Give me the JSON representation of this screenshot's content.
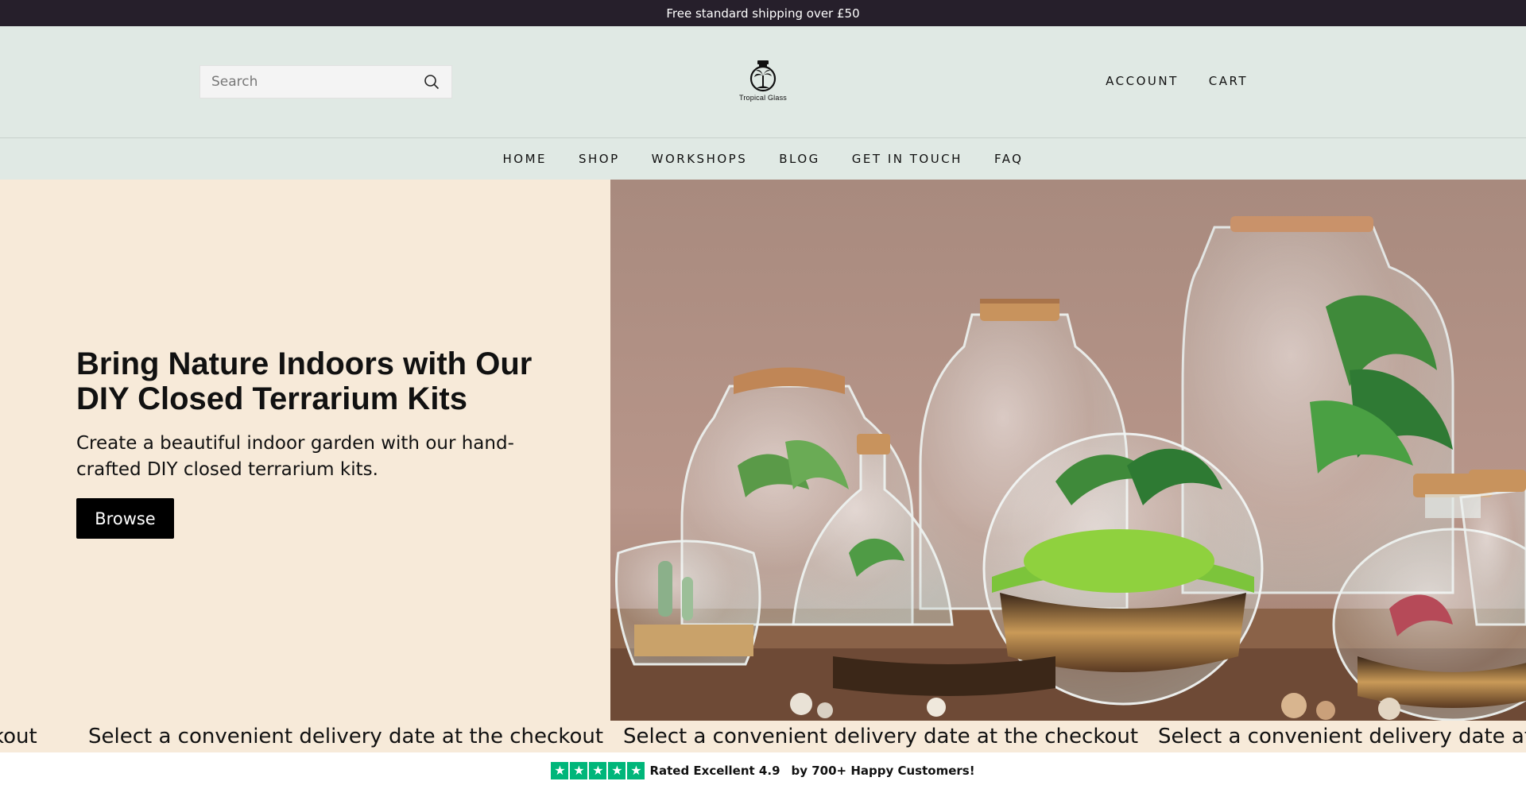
{
  "announcement": "Free standard shipping over £50",
  "header": {
    "search_placeholder": "Search",
    "search_icon": "search-icon",
    "logo_caption": "Tropical Glass",
    "account_label": "ACCOUNT",
    "cart_label": "CART"
  },
  "nav": {
    "items": [
      "HOME",
      "SHOP",
      "WORKSHOPS",
      "BLOG",
      "GET IN TOUCH",
      "FAQ"
    ]
  },
  "hero": {
    "title": "Bring Nature Indoors with Our DIY Closed Terrarium Kits",
    "subtitle": "Create a beautiful indoor garden with our hand-crafted DIY closed terrarium kits.",
    "button_label": "Browse",
    "image_subject": "glass terrariums with cork lids and plants"
  },
  "marquee": {
    "text": "Select a convenient delivery date at the checkout",
    "partial_left": "kout",
    "partial_right": "Select a convenient delivery date at t"
  },
  "trust": {
    "rating_text": "Rated Excellent 4.9",
    "customers_text": "by 700+ Happy Customers!",
    "star_color": "#00b67a"
  },
  "colors": {
    "announcement_bg": "#261f2b",
    "header_bg": "#e0e9e4",
    "hero_bg": "#f7ead9",
    "button_bg": "#000000"
  }
}
